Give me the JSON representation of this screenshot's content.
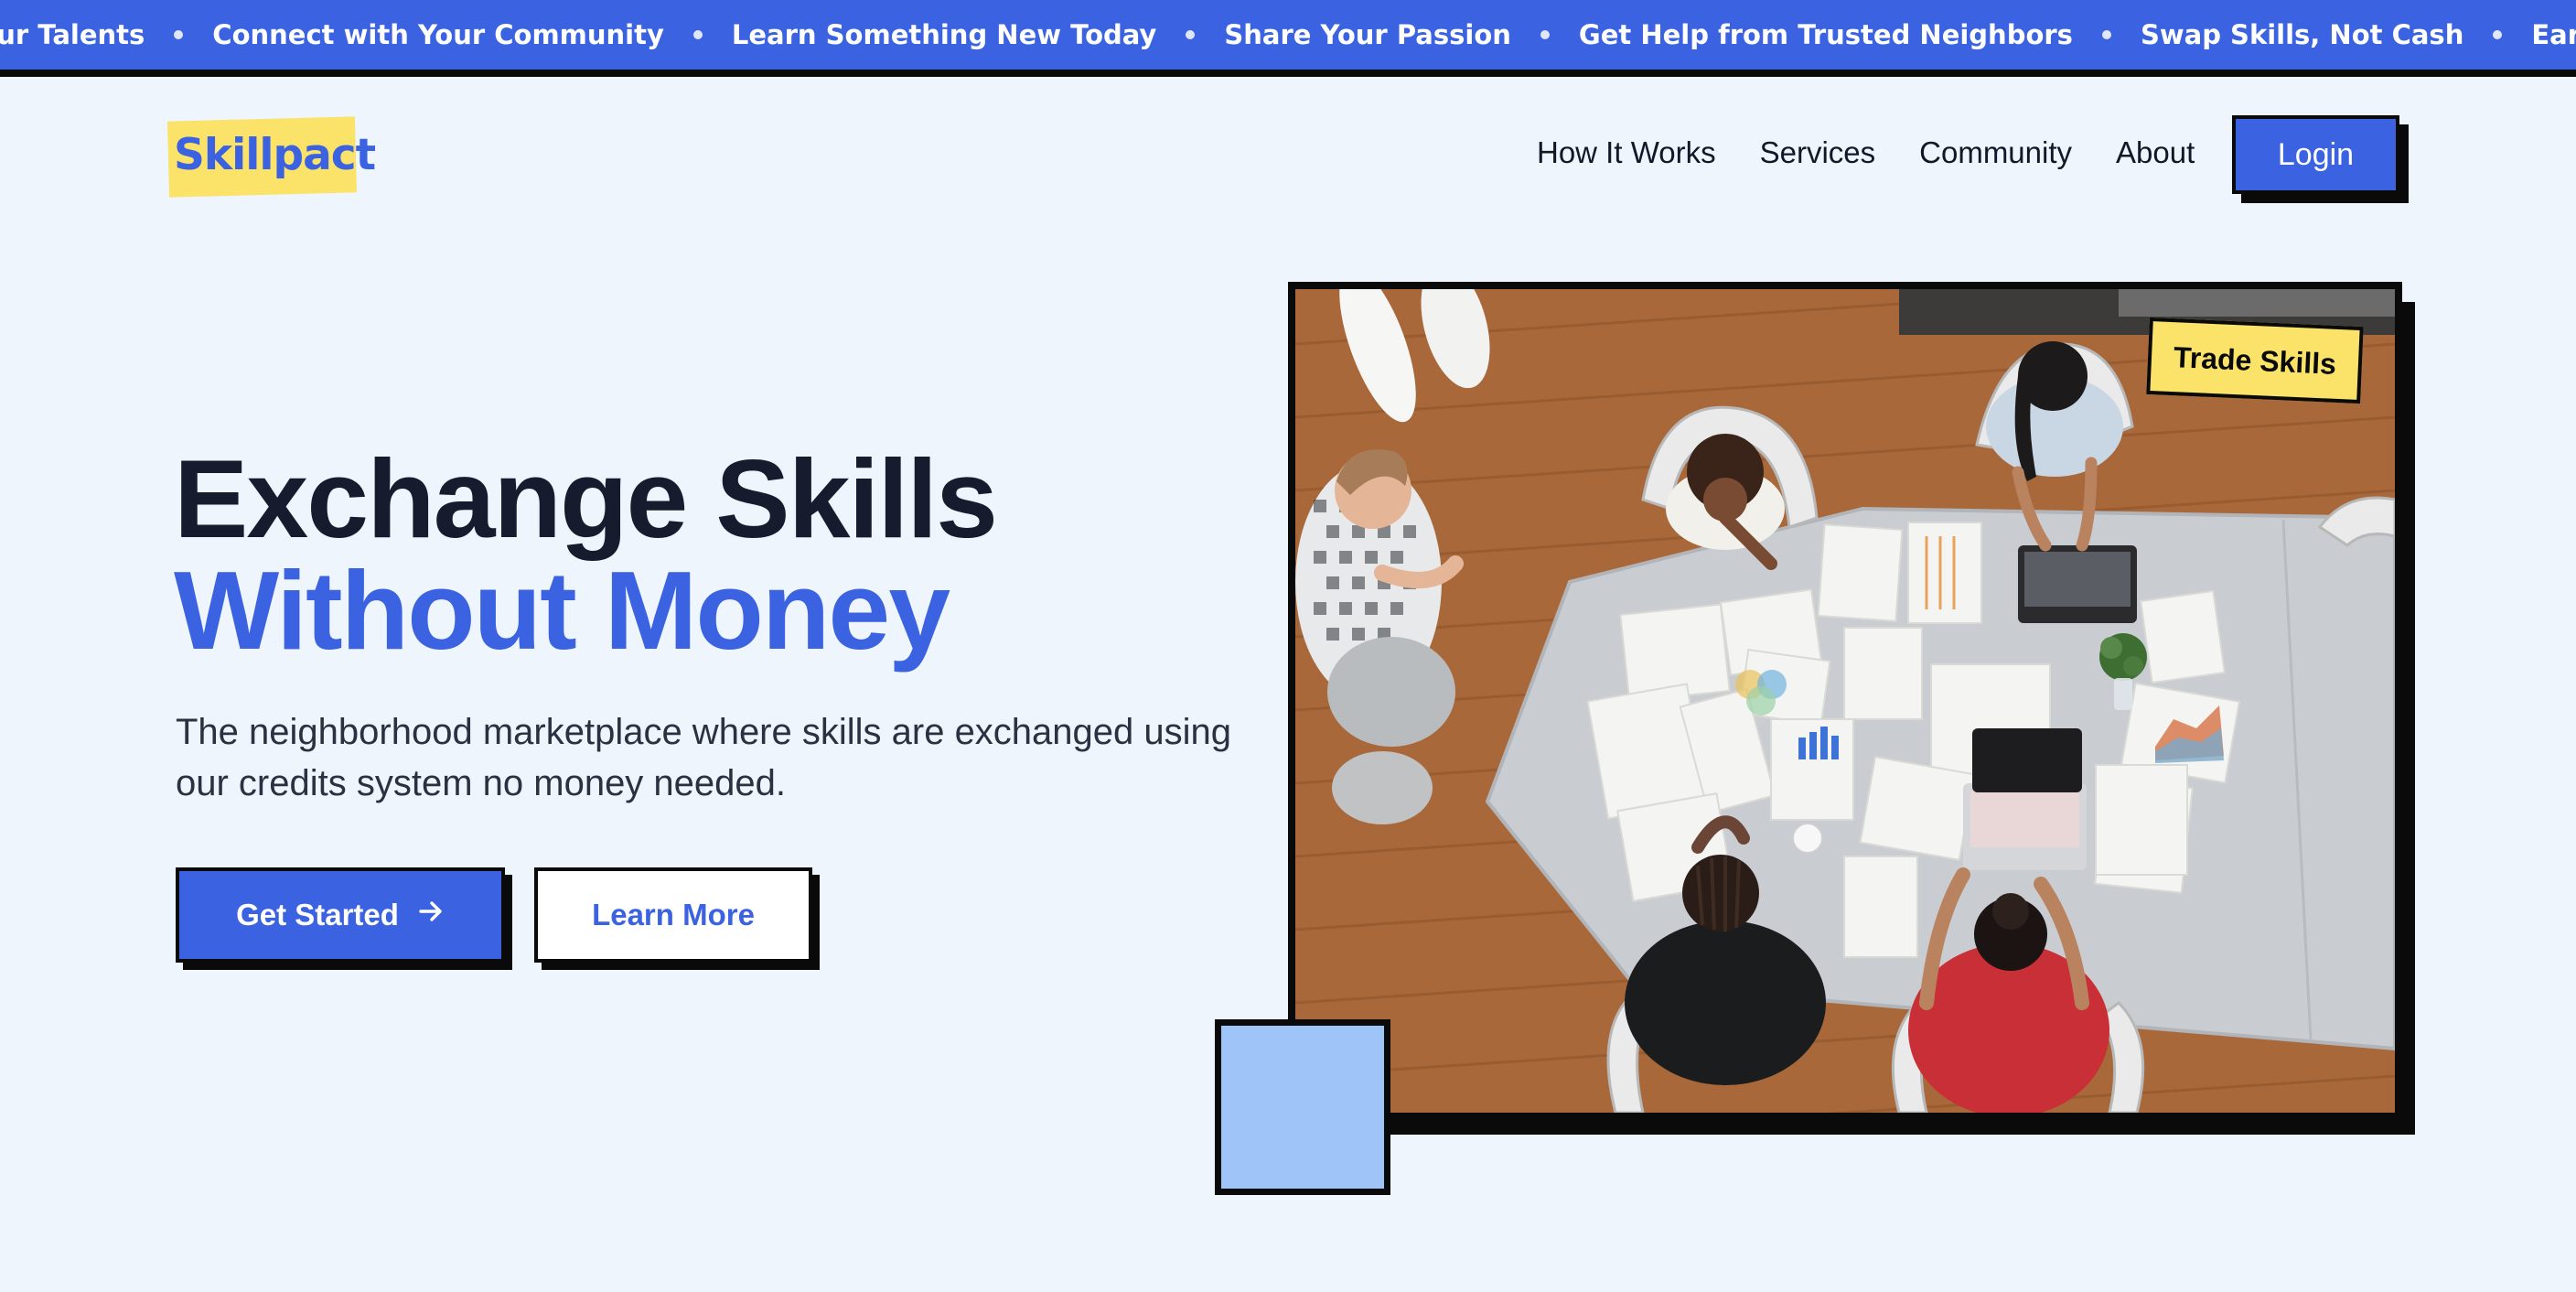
{
  "marquee": {
    "items": [
      "Your Talents",
      "Connect with Your Community",
      "Learn Something New Today",
      "Share Your Passion",
      "Get Help from Trusted Neighbors",
      "Swap Skills, Not Cash",
      "Earn Credits for Your Talents"
    ]
  },
  "brand": {
    "logo_text": "Skillpact",
    "accent_color": "#3b62e0",
    "highlight_color": "#fbe268"
  },
  "nav": {
    "links": [
      "How It Works",
      "Services",
      "Community",
      "About"
    ],
    "login_label": "Login"
  },
  "hero": {
    "title_line1": "Exchange Skills",
    "title_line2": "Without Money",
    "subtitle": "The neighborhood marketplace where skills are exchanged using our credits system no money needed.",
    "primary_cta": "Get Started",
    "primary_cta_icon": "arrow-right-icon",
    "secondary_cta": "Learn More",
    "image_tag": "Trade Skills"
  }
}
